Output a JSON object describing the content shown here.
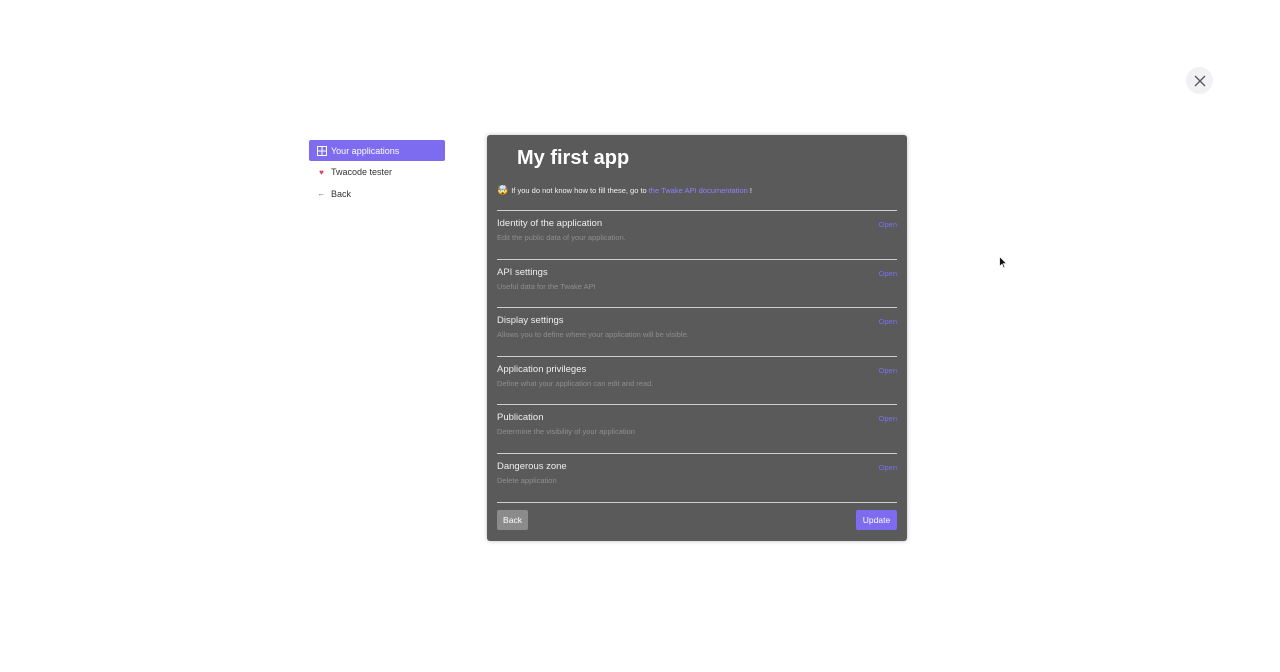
{
  "close": {
    "icon": "close-icon"
  },
  "sidebar": {
    "items": [
      {
        "label": "Your applications",
        "icon": "grid-icon",
        "active": true
      },
      {
        "label": "Twacode tester",
        "icon": "heart-icon",
        "active": false
      },
      {
        "label": "Back",
        "icon": "arrow-left-icon",
        "active": false
      }
    ]
  },
  "panel": {
    "title": "My first app",
    "hint_prefix": "If you do not know how to fill these, go to",
    "hint_link": "the Twake API documentation",
    "hint_suffix": "!",
    "sections": [
      {
        "title": "Identity of the application",
        "desc": "Edit the public data of your application.",
        "action": "Open"
      },
      {
        "title": "API settings",
        "desc": "Useful data for the Twake API",
        "action": "Open"
      },
      {
        "title": "Display settings",
        "desc": "Allows you to define where your application will be visible.",
        "action": "Open"
      },
      {
        "title": "Application privileges",
        "desc": "Define what your application can edit and read.",
        "action": "Open"
      },
      {
        "title": "Publication",
        "desc": "Determine the visibility of your application",
        "action": "Open"
      },
      {
        "title": "Dangerous zone",
        "desc": "Delete application",
        "action": "Open"
      }
    ],
    "back_label": "Back",
    "update_label": "Update"
  },
  "colors": {
    "accent": "#7e6cf0",
    "panel_bg": "#5a5a5a",
    "link": "#8e80f7"
  }
}
